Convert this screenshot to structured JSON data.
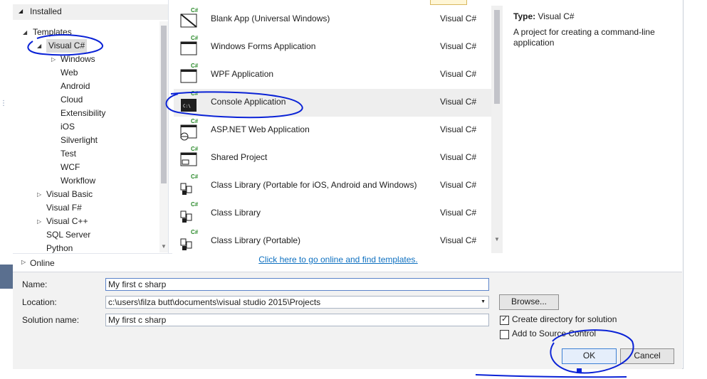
{
  "tree": {
    "installed": "Installed",
    "templates": "Templates",
    "items": [
      {
        "label": "Visual C#",
        "level": 1,
        "arrow": "expanded",
        "selected": true
      },
      {
        "label": "Windows",
        "level": 2,
        "arrow": "collapsed"
      },
      {
        "label": "Web",
        "level": 2,
        "arrow": ""
      },
      {
        "label": "Android",
        "level": 2,
        "arrow": ""
      },
      {
        "label": "Cloud",
        "level": 2,
        "arrow": ""
      },
      {
        "label": "Extensibility",
        "level": 2,
        "arrow": ""
      },
      {
        "label": "iOS",
        "level": 2,
        "arrow": ""
      },
      {
        "label": "Silverlight",
        "level": 2,
        "arrow": ""
      },
      {
        "label": "Test",
        "level": 2,
        "arrow": ""
      },
      {
        "label": "WCF",
        "level": 2,
        "arrow": ""
      },
      {
        "label": "Workflow",
        "level": 2,
        "arrow": ""
      },
      {
        "label": "Visual Basic",
        "level": 1,
        "arrow": "collapsed"
      },
      {
        "label": "Visual F#",
        "level": 1,
        "arrow": ""
      },
      {
        "label": "Visual C++",
        "level": 1,
        "arrow": "collapsed"
      },
      {
        "label": "SQL Server",
        "level": 1,
        "arrow": ""
      },
      {
        "label": "Python",
        "level": 1,
        "arrow": ""
      }
    ],
    "online": "Online"
  },
  "templates": [
    {
      "name": "Blank App (Universal Windows)",
      "lang": "Visual C#",
      "icon": "blank-app-icon"
    },
    {
      "name": "Windows Forms Application",
      "lang": "Visual C#",
      "icon": "window-icon"
    },
    {
      "name": "WPF Application",
      "lang": "Visual C#",
      "icon": "wpf-window-icon"
    },
    {
      "name": "Console Application",
      "lang": "Visual C#",
      "icon": "console-icon",
      "selected": true
    },
    {
      "name": "ASP.NET Web Application",
      "lang": "Visual C#",
      "icon": "globe-window-icon"
    },
    {
      "name": "Shared Project",
      "lang": "Visual C#",
      "icon": "shared-project-icon"
    },
    {
      "name": "Class Library (Portable for iOS, Android and Windows)",
      "lang": "Visual C#",
      "icon": "class-library-icon"
    },
    {
      "name": "Class Library",
      "lang": "Visual C#",
      "icon": "class-library-icon"
    },
    {
      "name": "Class Library (Portable)",
      "lang": "Visual C#",
      "icon": "class-library-icon"
    }
  ],
  "online_link": "Click here to go online and find templates.",
  "description": {
    "type_label": "Type:",
    "type_value": "Visual C#",
    "text": "A project for creating a command-line application"
  },
  "form": {
    "name_label": "Name:",
    "name_value": "My first c sharp",
    "location_label": "Location:",
    "location_value": "c:\\users\\filza butt\\documents\\visual studio 2015\\Projects",
    "solution_label": "Solution name:",
    "solution_value": "My first c sharp",
    "browse": "Browse...",
    "create_dir": "Create directory for solution",
    "create_dir_checked": true,
    "add_source": "Add to Source Control",
    "add_source_checked": false,
    "ok": "OK",
    "cancel": "Cancel"
  },
  "colors": {
    "annotation": "#0a22d6",
    "link": "#0e70c0",
    "csharp_badge": "#2a8a2a"
  }
}
